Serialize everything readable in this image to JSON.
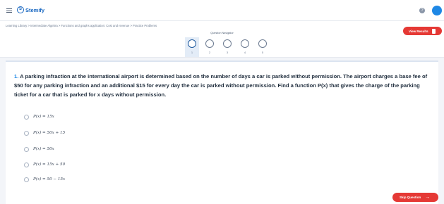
{
  "header": {
    "brand": "Stemify",
    "logo_glyph": "S",
    "help_glyph": "?"
  },
  "breadcrumb": "Learning Library > Intermediate Algebra > Functions and graphs application: Cost and revenue > Practice Problems",
  "view_results_label": "View Results",
  "navigator": {
    "title": "Question Navigator",
    "items": [
      "1",
      "2",
      "3",
      "4",
      "5"
    ],
    "active_index": 0
  },
  "question": {
    "number": "1.",
    "text": "A parking infraction at the international airport is determined based on the number of days a car is parked without permission. The airport charges a base fee of $50 for any parking infraction and an additional $15 for every day the car is parked without permission. Find a function P(x) that gives the charge of the parking ticket for a car that is parked for x days without permission."
  },
  "options": [
    "P(x) = 15x",
    "P(x) = 50x + 15",
    "P(x) = 50x",
    "P(x) = 15x + 50",
    "P(x) = 50 − 15x"
  ],
  "skip_label": "Skip Question",
  "skip_arrow": "→",
  "colors": {
    "accent": "#1e88e5",
    "brand": "#1565c0",
    "danger": "#e53935"
  }
}
